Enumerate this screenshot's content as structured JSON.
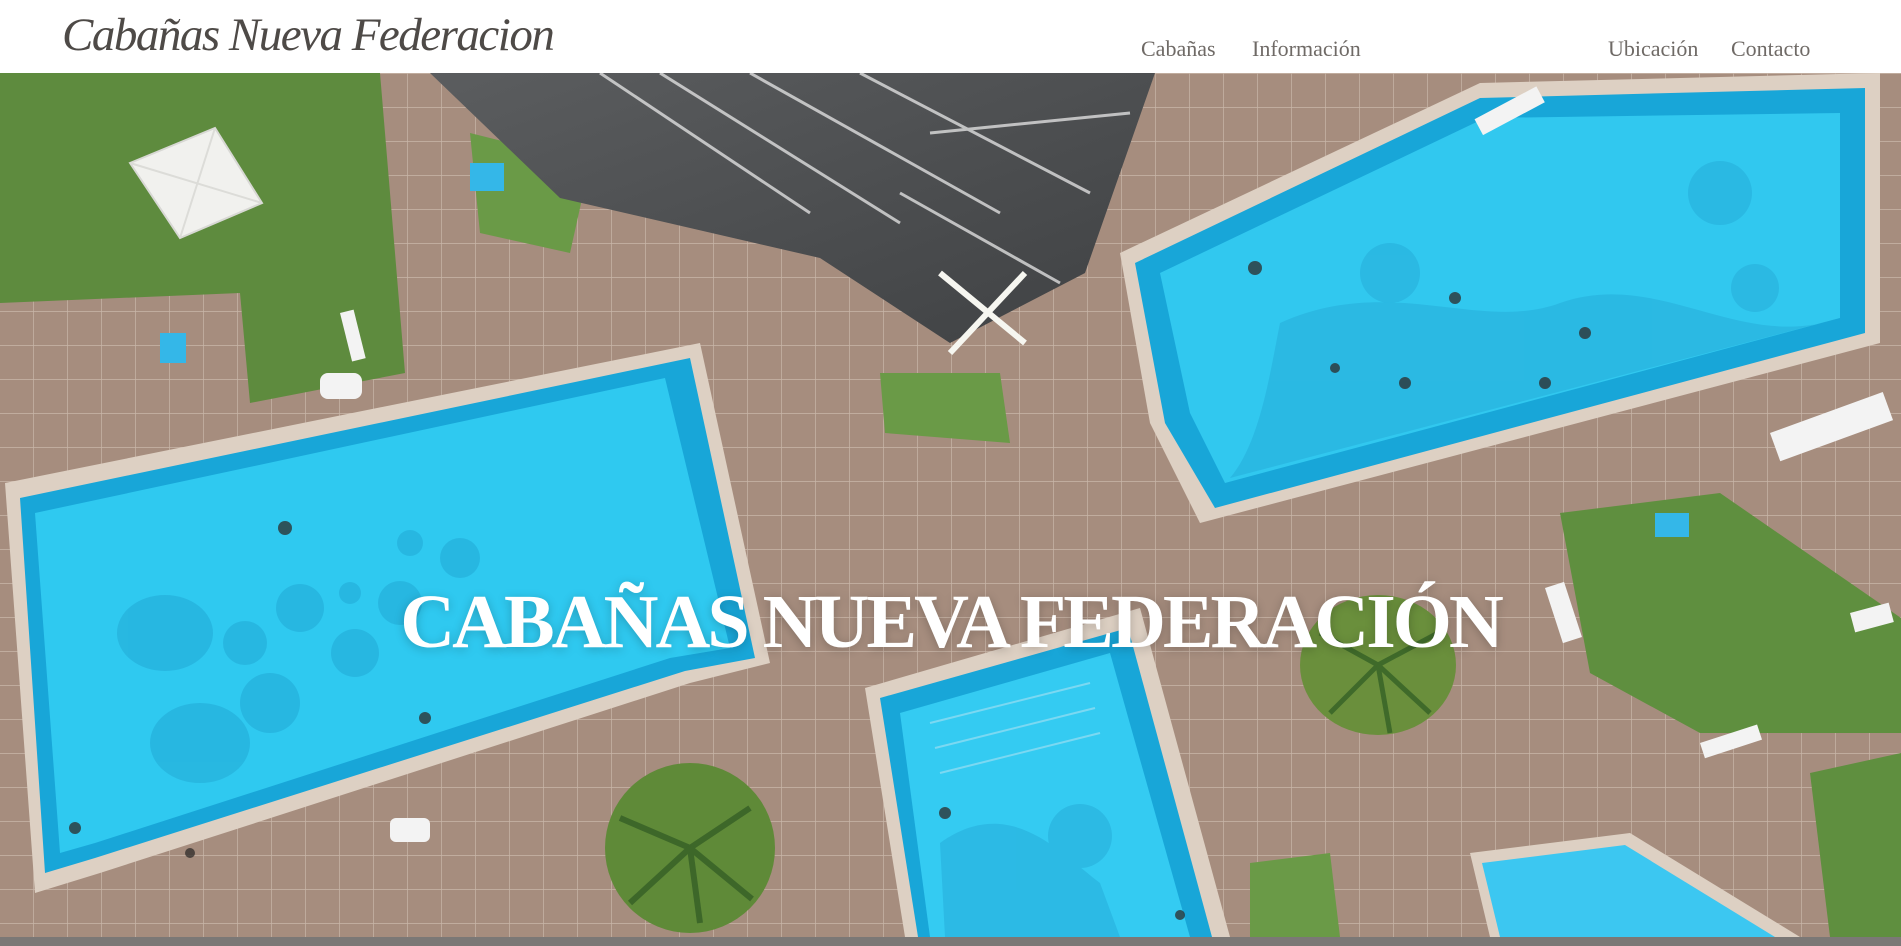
{
  "site": {
    "logo_text": "Cabañas Nueva Federacion"
  },
  "nav": {
    "items": [
      {
        "label": "Cabañas"
      },
      {
        "label": "Información"
      },
      {
        "label": "Ubicación"
      },
      {
        "label": "Contacto"
      }
    ]
  },
  "hero": {
    "title": "CABAÑAS NUEVA FEDERACIÓN"
  },
  "colors": {
    "text_dark": "#4e4a47",
    "nav_text": "#6f6a66",
    "pool_water": "#2cc7ee",
    "grass": "#5e8b3e",
    "paving": "#a68d7e"
  }
}
